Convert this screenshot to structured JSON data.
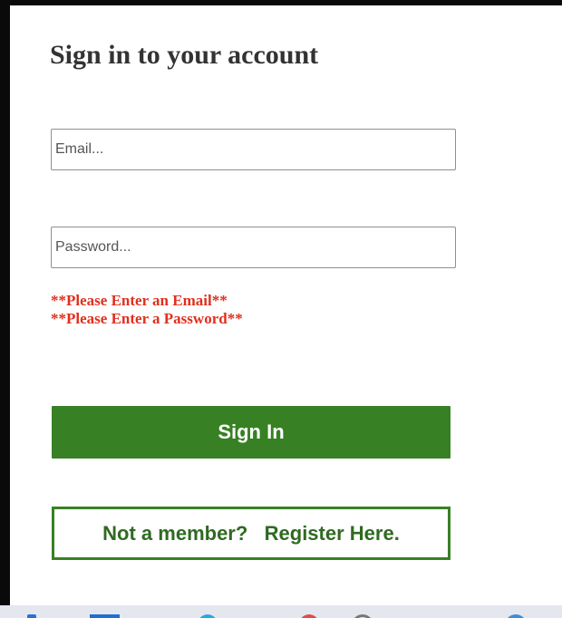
{
  "form": {
    "title": "Sign in to your account",
    "email_placeholder": "Email...",
    "email_value": "",
    "password_placeholder": "Password...",
    "password_value": "",
    "errors": [
      "**Please Enter an Email**",
      "**Please Enter a Password**"
    ],
    "signin_label": "Sign In",
    "register_label": "Not a member?   Register Here."
  },
  "taskbar": {
    "icons": [
      "app-icon",
      "window-icon",
      "browser-icon",
      "media-icon",
      "search-icon",
      "settings-icon"
    ]
  },
  "colors": {
    "accent_green": "#388024",
    "error_red": "#e0301e",
    "title_gray": "#333333",
    "taskbar_bg": "#e5e7ef"
  }
}
